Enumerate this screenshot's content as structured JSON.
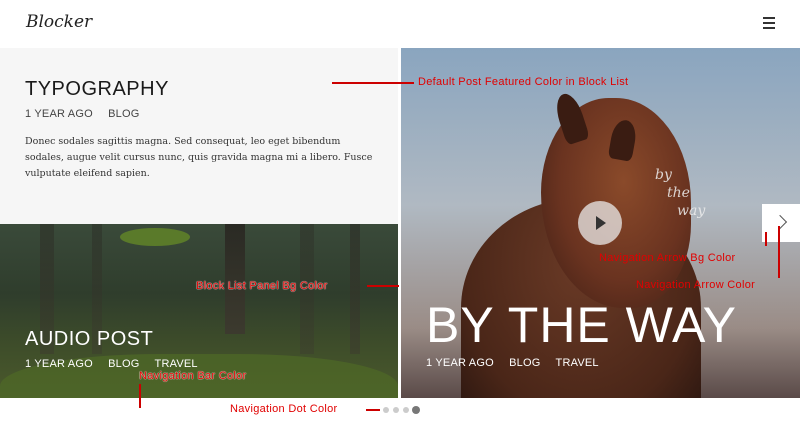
{
  "header": {
    "logo": "Blocker",
    "menu_icon": "hamburger-menu-icon"
  },
  "posts": [
    {
      "title": "TYPOGRAPHY",
      "meta": [
        "1 YEAR AGO",
        "BLOG"
      ],
      "excerpt": "Donec sodales sagittis magna. Sed consequat, leo eget bibendum sodales, augue velit cursus nunc, quis gravida magna mi a libero. Fusce vulputate eleifend sapien."
    },
    {
      "title": "AUDIO POST",
      "meta": [
        "1 YEAR AGO",
        "BLOG",
        "TRAVEL"
      ]
    },
    {
      "title": "BY THE WAY",
      "meta": [
        "1 YEAR AGO",
        "BLOG",
        "TRAVEL"
      ],
      "handwriting": [
        "by",
        "the",
        "way"
      ],
      "play_icon": "play-icon"
    }
  ],
  "navigation": {
    "arrow_icon": "chevron-right-icon",
    "dots_total": 4,
    "active_dot": 4
  },
  "annotations": {
    "default_post": "Default Post Featured Color in Block List",
    "block_list_panel": "Block List Panel Bg Color",
    "nav_arrow_bg": "Navigation Arrow Bg Color",
    "nav_arrow": "Navigation Arrow Color",
    "nav_bar": "Navigation Bar Color",
    "nav_dot": "Navigation Dot Color"
  },
  "colors": {
    "annotation": "#e10000",
    "panel_bg": "#f6f6f6"
  }
}
